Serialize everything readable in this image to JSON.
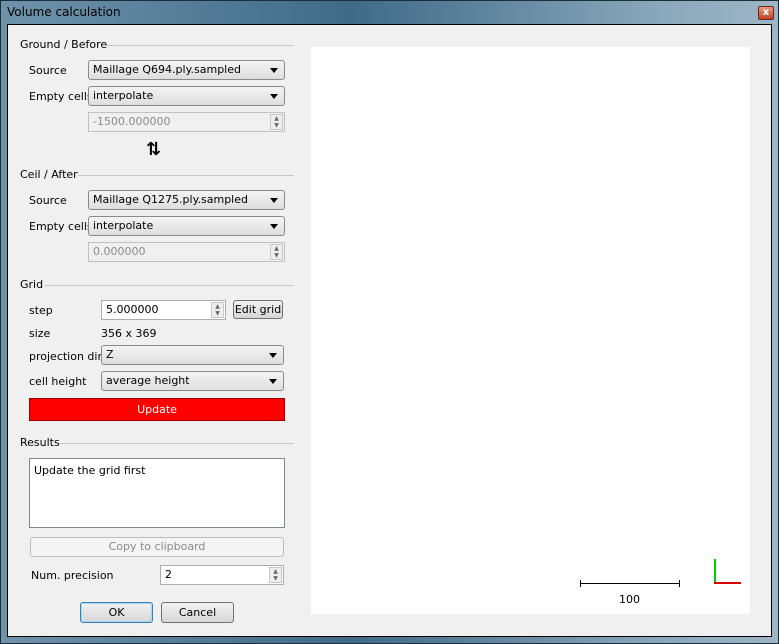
{
  "window": {
    "title": "Volume calculation"
  },
  "ground": {
    "title": "Ground / Before",
    "source_label": "Source",
    "source_value": "Maillage Q694.ply.sampled",
    "empty_label": "Empty cells",
    "empty_value": "interpolate",
    "height_value": "-1500.000000"
  },
  "swap_icon": "up-down-arrows",
  "ceil": {
    "title": "Ceil / After",
    "source_label": "Source",
    "source_value": "Maillage Q1275.ply.sampled",
    "empty_label": "Empty cells",
    "empty_value": "interpolate",
    "height_value": "0.000000"
  },
  "grid": {
    "title": "Grid",
    "step_label": "step",
    "step_value": "5.000000",
    "edit_grid": "Edit grid",
    "size_label": "size",
    "size_value": "356 x 369",
    "proj_label": "projection dir.",
    "proj_value": "Z",
    "cell_label": "cell height",
    "cell_value": "average height",
    "update": "Update",
    "update_color": "#ff0000"
  },
  "results": {
    "title": "Results",
    "text": "Update the grid first",
    "copy": "Copy to clipboard",
    "precision_label": "Num. precision",
    "precision_value": "2"
  },
  "buttons": {
    "ok": "OK",
    "cancel": "Cancel"
  },
  "view": {
    "scale_label": "100",
    "axis_x_color": "#dd0000",
    "axis_y_color": "#00cc00"
  }
}
